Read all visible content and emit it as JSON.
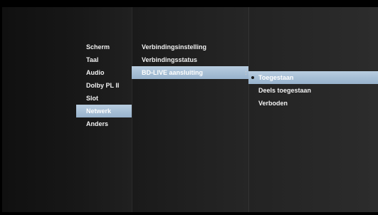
{
  "menu_level1": {
    "items": [
      {
        "label": "Scherm"
      },
      {
        "label": "Taal"
      },
      {
        "label": "Audio"
      },
      {
        "label": "Dolby PL II"
      },
      {
        "label": "Slot"
      },
      {
        "label": "Netwerk",
        "selected": true
      },
      {
        "label": "Anders"
      }
    ]
  },
  "menu_level2": {
    "items": [
      {
        "label": "Verbindingsinstelling"
      },
      {
        "label": "Verbindingsstatus"
      },
      {
        "label": "BD-LIVE aansluiting",
        "selected": true,
        "marker": ":"
      }
    ]
  },
  "menu_level3": {
    "items": [
      {
        "label": "Toegestaan",
        "selected": true,
        "checked": true
      },
      {
        "label": "Deels toegestaan"
      },
      {
        "label": "Verboden"
      }
    ]
  },
  "colors": {
    "highlight": "#a9c1d8",
    "text": "#f2f2f2",
    "background": "#1c1c1c"
  }
}
